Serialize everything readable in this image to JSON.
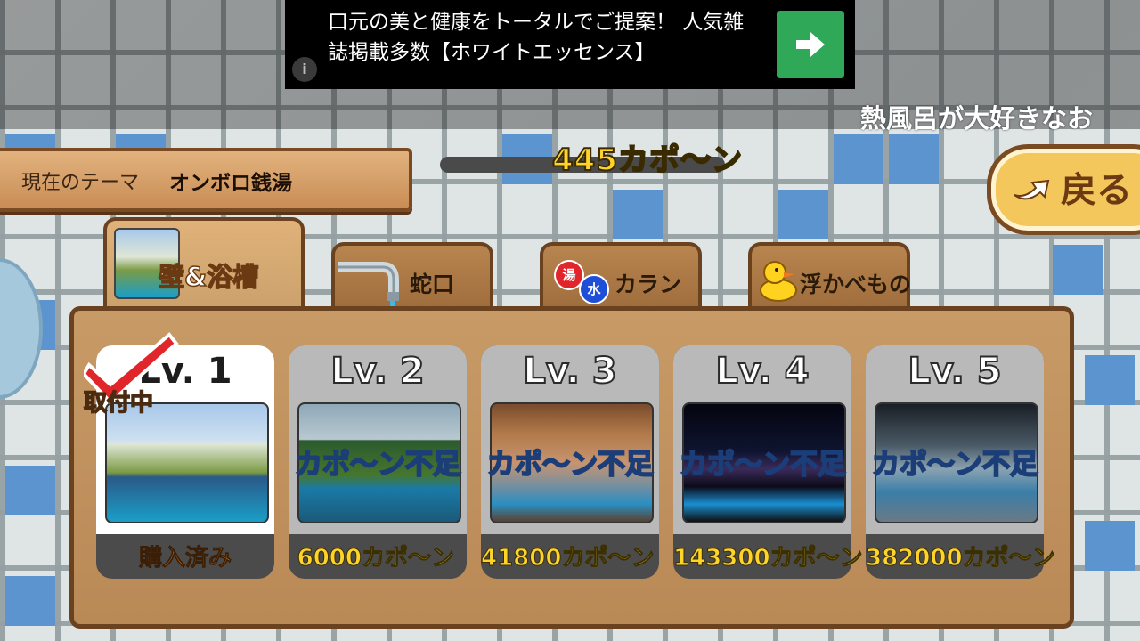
{
  "ad": {
    "text": "口元の美と健康をトータルでご提案！ 人気雑誌掲載多数【ホワイトエッセンス】",
    "info_glyph": "i",
    "action_icon": "arrow-right-icon"
  },
  "marquee": {
    "text": "熱風呂が大好きなお"
  },
  "theme": {
    "label": "現在のテーマ",
    "value": "オンボロ銭湯"
  },
  "currency": {
    "amount_text": "445カポ〜ン"
  },
  "back_button": {
    "label": "戻る",
    "icon": "return-arrow-icon"
  },
  "tabs": [
    {
      "label": "壁&浴槽",
      "active": true
    },
    {
      "label": "蛇口",
      "active": false
    },
    {
      "label": "カラン",
      "active": false,
      "badges": [
        "湯",
        "水"
      ]
    },
    {
      "label": "浮かべもの",
      "active": false
    }
  ],
  "cards": [
    {
      "level": "Lv. 1",
      "status": "購入済み",
      "installed": true,
      "installed_label": "取付中"
    },
    {
      "level": "Lv. 2",
      "price": "6000カポ〜ン",
      "insufficient": "カポ〜ン不足"
    },
    {
      "level": "Lv. 3",
      "price": "41800カポ〜ン",
      "insufficient": "カポ〜ン不足"
    },
    {
      "level": "Lv. 4",
      "price": "143300カポ〜ン",
      "insufficient": "カポ〜ン不足"
    },
    {
      "level": "Lv. 5",
      "price": "382000カポ〜ン",
      "insufficient": "カポ〜ン不足"
    }
  ],
  "colors": {
    "accent_gold": "#ffd42a",
    "wood": "#c79a66",
    "wood_border": "#6b4220",
    "tile_blue": "#5b94cf",
    "ad_button": "#2fa858"
  }
}
